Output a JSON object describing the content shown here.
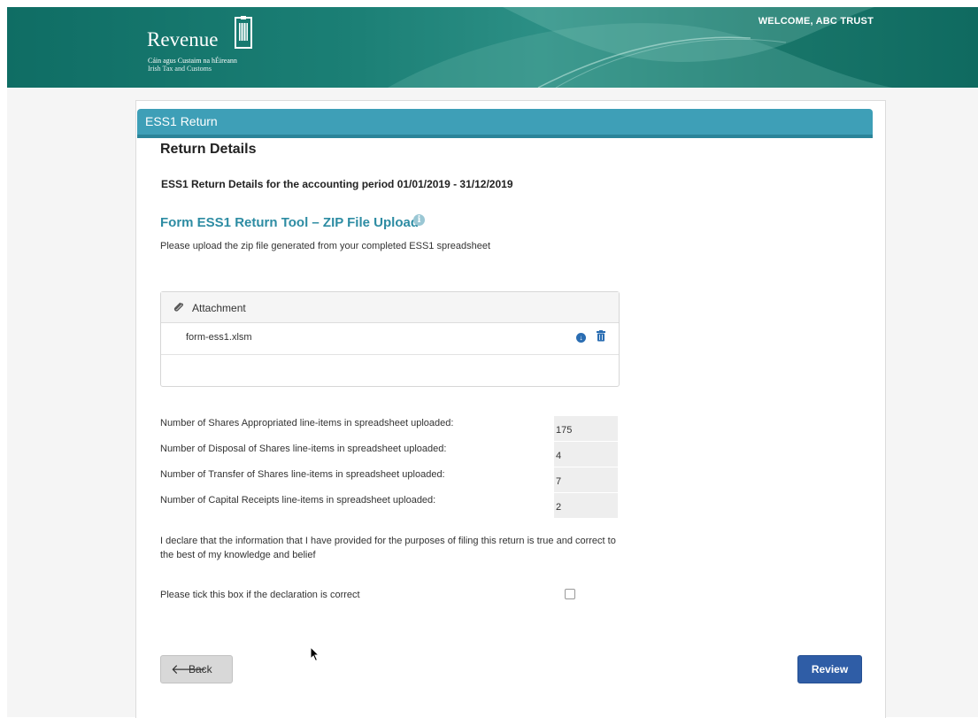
{
  "header": {
    "brand_name": "Revenue",
    "brand_irish": "Cáin agus Custaim na hÉireann",
    "brand_english": "Irish Tax and Customs",
    "welcome": "WELCOME, ABC TRUST"
  },
  "panel": {
    "title": "ESS1 Return",
    "section_heading": "Return Details",
    "period_text": "ESS1 Return Details for the accounting period 01/01/2019 - 31/12/2019",
    "tool_heading": "Form ESS1 Return Tool – ZIP File Upload",
    "info_icon": "i",
    "upload_instruction": "Please upload the zip file generated from your completed ESS1 spreadsheet"
  },
  "attachment": {
    "header_label": "Attachment",
    "file_name": "form-ess1.xlsm"
  },
  "counts": [
    {
      "label": "Number of Shares Appropriated line-items in spreadsheet uploaded:",
      "value": "175"
    },
    {
      "label": "Number of Disposal of Shares line-items in spreadsheet uploaded:",
      "value": "4"
    },
    {
      "label": "Number of Transfer of Shares line-items in spreadsheet uploaded:",
      "value": "7"
    },
    {
      "label": "Number of Capital Receipts line-items in spreadsheet uploaded:",
      "value": "2"
    }
  ],
  "declaration": {
    "text": "I declare that the information that I have provided for the purposes of filing this return is true and correct to the best of my knowledge and belief",
    "tick_label": "Please tick this box if the declaration is correct",
    "checked": false
  },
  "buttons": {
    "back_label": "Back",
    "review_label": "Review"
  },
  "colors": {
    "header_teal": "#1b7f75",
    "panel_head": "#3e9fb7",
    "tool_heading": "#2d8ca3",
    "review_button": "#2f5da6"
  },
  "icons": [
    "paperclip-icon",
    "download-icon",
    "trash-icon",
    "arrow-left-icon",
    "info-icon",
    "harp-icon"
  ]
}
